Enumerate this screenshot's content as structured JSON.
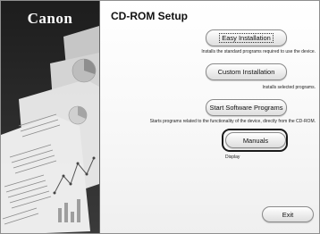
{
  "brand": {
    "logo_text": "Canon"
  },
  "window": {
    "title": "CD-ROM Setup"
  },
  "options": [
    {
      "label": "Easy Installation",
      "description": "Installs the standard programs required to use the device."
    },
    {
      "label": "Custom Installation",
      "description": "Installs selected programs."
    },
    {
      "label": "Start Software Programs",
      "description": "Starts programs related to the functionality of the device, directly from the CD-ROM."
    },
    {
      "label": "Manuals",
      "description": "Display"
    }
  ],
  "footer": {
    "exit_label": "Exit"
  },
  "colors": {
    "sidebar_bg": "#222222",
    "highlight": "#1a1a1a"
  }
}
